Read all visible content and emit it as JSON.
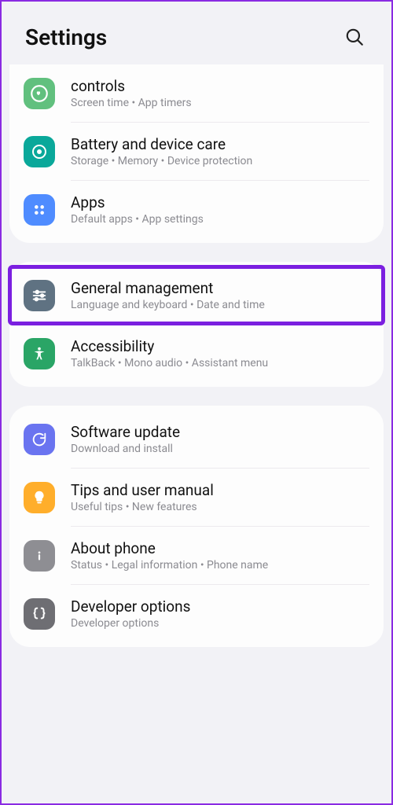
{
  "header": {
    "title": "Settings"
  },
  "groups": [
    {
      "items": [
        {
          "id": "controls",
          "title": "controls",
          "sub": "Screen time  •  App timers",
          "iconBg": "#61c07e"
        },
        {
          "id": "battery",
          "title": "Battery and device care",
          "sub": "Storage  •  Memory  •  Device protection",
          "iconBg": "#0aa89a"
        },
        {
          "id": "apps",
          "title": "Apps",
          "sub": "Default apps  •  App settings",
          "iconBg": "#4f8cff"
        }
      ]
    },
    {
      "items": [
        {
          "id": "general",
          "title": "General management",
          "sub": "Language and keyboard  •  Date and time",
          "iconBg": "#5f7282"
        },
        {
          "id": "accessibility",
          "title": "Accessibility",
          "sub": "TalkBack  •  Mono audio  •  Assistant menu",
          "iconBg": "#2aa566"
        }
      ]
    },
    {
      "items": [
        {
          "id": "software",
          "title": "Software update",
          "sub": "Download and install",
          "iconBg": "#6a74f0"
        },
        {
          "id": "tips",
          "title": "Tips and user manual",
          "sub": "Useful tips  •  New features",
          "iconBg": "#ffae2b"
        },
        {
          "id": "about",
          "title": "About phone",
          "sub": "Status  •  Legal information  •  Phone name",
          "iconBg": "#8e8e93"
        },
        {
          "id": "developer",
          "title": "Developer options",
          "sub": "Developer options",
          "iconBg": "#6e6e73"
        }
      ]
    }
  ]
}
